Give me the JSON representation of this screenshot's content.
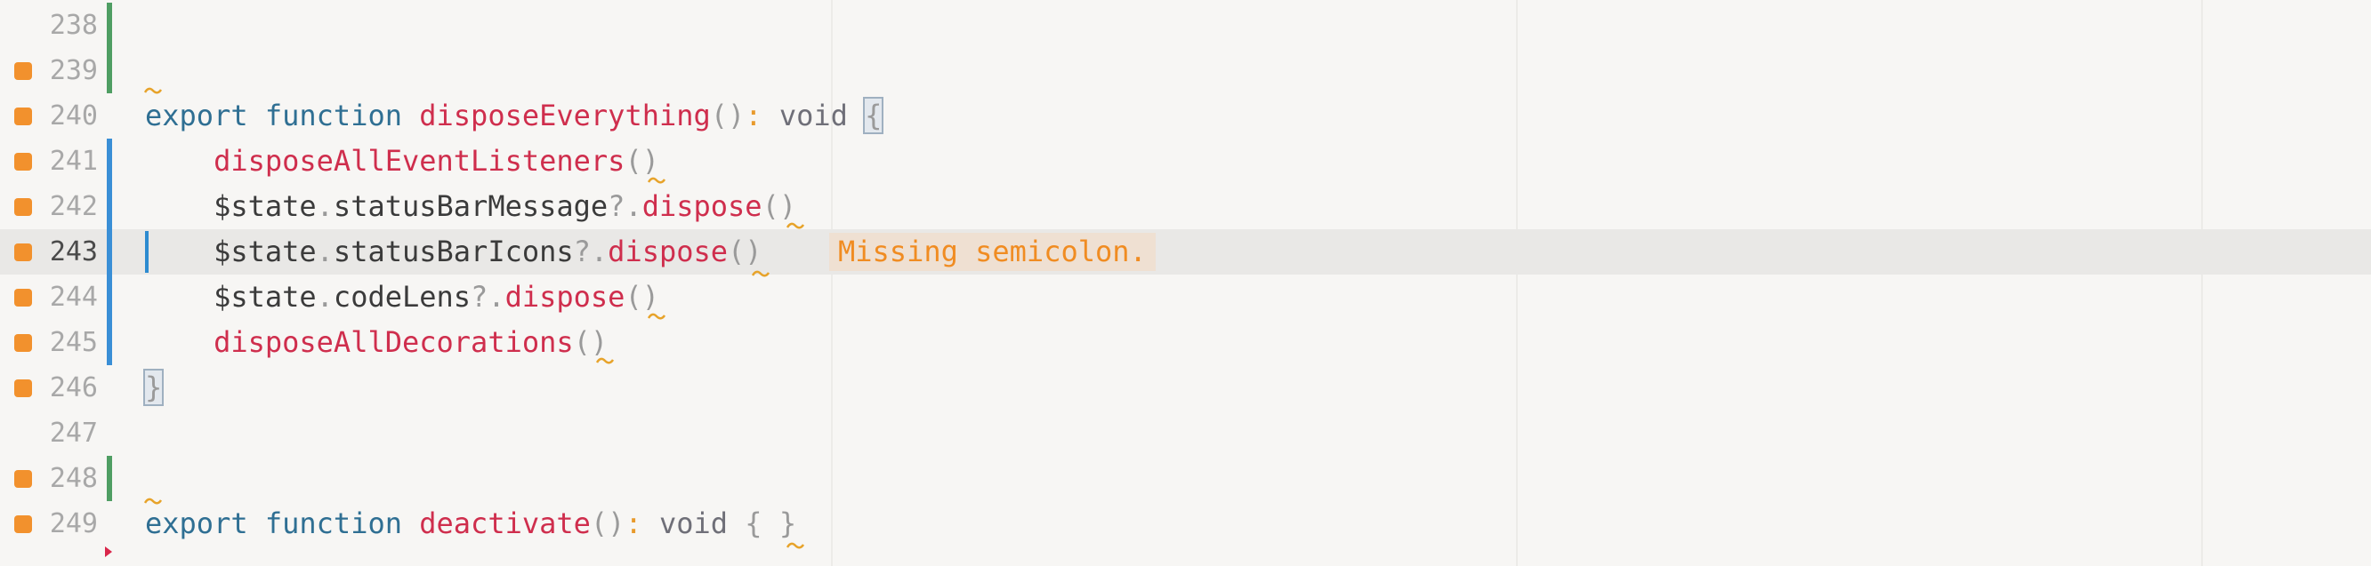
{
  "editor": {
    "colors": {
      "background": "#f7f6f4",
      "keyword": "#2f6f93",
      "function": "#cf2e4d",
      "warning": "#f08c22",
      "added_bar": "#4f9e63",
      "modified_bar": "#3a8fd6"
    },
    "lines": [
      {
        "number": "238",
        "tokens": []
      },
      {
        "number": "239",
        "tokens": []
      },
      {
        "number": "240",
        "tokens": [
          {
            "t": "export",
            "c": "kw"
          },
          {
            "t": " ",
            "c": "pl"
          },
          {
            "t": "function",
            "c": "kw"
          },
          {
            "t": " ",
            "c": "pl"
          },
          {
            "t": "disposeEverything",
            "c": "fn"
          },
          {
            "t": "()",
            "c": "pu"
          },
          {
            "t": ":",
            "c": "op"
          },
          {
            "t": " ",
            "c": "pl"
          },
          {
            "t": "void",
            "c": "ty"
          },
          {
            "t": " ",
            "c": "pl"
          },
          {
            "t": "{",
            "c": "pu bm"
          }
        ]
      },
      {
        "number": "241",
        "tokens": [
          {
            "t": "    ",
            "c": "pl"
          },
          {
            "t": "disposeAllEventListeners",
            "c": "fn"
          },
          {
            "t": "()",
            "c": "pu"
          }
        ]
      },
      {
        "number": "242",
        "tokens": [
          {
            "t": "    ",
            "c": "pl"
          },
          {
            "t": "$state",
            "c": "pl"
          },
          {
            "t": ".",
            "c": "pu"
          },
          {
            "t": "statusBarMessage",
            "c": "pl"
          },
          {
            "t": "?.",
            "c": "pu"
          },
          {
            "t": "dispose",
            "c": "fn"
          },
          {
            "t": "()",
            "c": "pu"
          }
        ]
      },
      {
        "number": "243",
        "tokens": [
          {
            "t": "    ",
            "c": "pl"
          },
          {
            "t": "$state",
            "c": "pl"
          },
          {
            "t": ".",
            "c": "pu"
          },
          {
            "t": "statusBarIcons",
            "c": "pl"
          },
          {
            "t": "?.",
            "c": "pu"
          },
          {
            "t": "dispose",
            "c": "fn"
          },
          {
            "t": "()",
            "c": "pu"
          }
        ]
      },
      {
        "number": "244",
        "tokens": [
          {
            "t": "    ",
            "c": "pl"
          },
          {
            "t": "$state",
            "c": "pl"
          },
          {
            "t": ".",
            "c": "pu"
          },
          {
            "t": "codeLens",
            "c": "pl"
          },
          {
            "t": "?.",
            "c": "pu"
          },
          {
            "t": "dispose",
            "c": "fn"
          },
          {
            "t": "()",
            "c": "pu"
          }
        ]
      },
      {
        "number": "245",
        "tokens": [
          {
            "t": "    ",
            "c": "pl"
          },
          {
            "t": "disposeAllDecorations",
            "c": "fn"
          },
          {
            "t": "()",
            "c": "pu"
          }
        ]
      },
      {
        "number": "246",
        "tokens": [
          {
            "t": "}",
            "c": "pu bm"
          }
        ]
      },
      {
        "number": "247",
        "tokens": []
      },
      {
        "number": "248",
        "tokens": []
      },
      {
        "number": "249",
        "tokens": [
          {
            "t": "export",
            "c": "kw"
          },
          {
            "t": " ",
            "c": "pl"
          },
          {
            "t": "function",
            "c": "kw"
          },
          {
            "t": " ",
            "c": "pl"
          },
          {
            "t": "deactivate",
            "c": "fn"
          },
          {
            "t": "()",
            "c": "pu"
          },
          {
            "t": ":",
            "c": "op"
          },
          {
            "t": " ",
            "c": "pl"
          },
          {
            "t": "void",
            "c": "ty"
          },
          {
            "t": " ",
            "c": "pl"
          },
          {
            "t": "{ }",
            "c": "pu"
          }
        ]
      }
    ],
    "diagnostic": {
      "message": "Missing semicolon."
    }
  }
}
